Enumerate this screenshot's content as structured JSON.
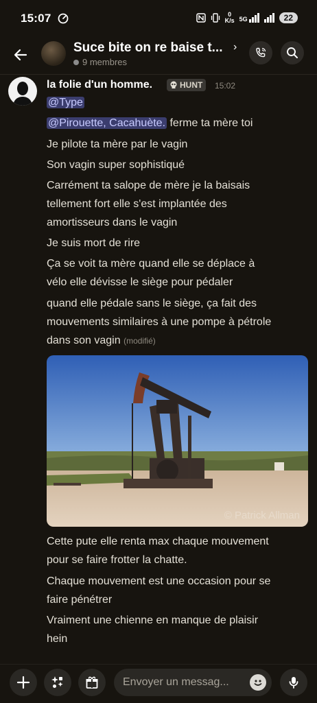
{
  "status": {
    "time": "15:07",
    "speed": "0",
    "speed_unit": "K/s",
    "network": "5G",
    "battery": "22"
  },
  "header": {
    "title": "Suce bite on re baise t...",
    "members": "9 membres"
  },
  "message": {
    "author": "la folie d'un homme.",
    "tag": "HUNT",
    "time": "15:02",
    "mention_1": "@Type",
    "mention_2": "@Pirouette, Cacahuète.",
    "line_1_rest": "ferme ta mère toi",
    "lines": [
      "Je pilote ta mère par le vagin",
      "Son vagin super sophistiqué",
      "Carrément ta salope de mère je la baisais",
      "tellement fort elle s'est implantée des",
      "amortisseurs dans le vagin",
      "Je suis mort de rire",
      "Ça se voit ta mère quand elle se déplace à",
      "vélo elle dévisse le siège pour pédaler",
      "quand elle pédale sans le siège, ça fait des",
      "mouvements similaires à une pompe à pétrole",
      "dans son vagin"
    ],
    "modified": "(modifié)",
    "photo_watermark": "© Patrick Allman",
    "after_lines": [
      "Cette pute elle renta max chaque mouvement",
      "pour se faire frotter la chatte.",
      "Chaque mouvement est une occasion pour se",
      "faire pénétrer",
      "Vraiment une chienne en manque de plaisir",
      "hein"
    ]
  },
  "composer": {
    "placeholder": "Envoyer un messag..."
  }
}
